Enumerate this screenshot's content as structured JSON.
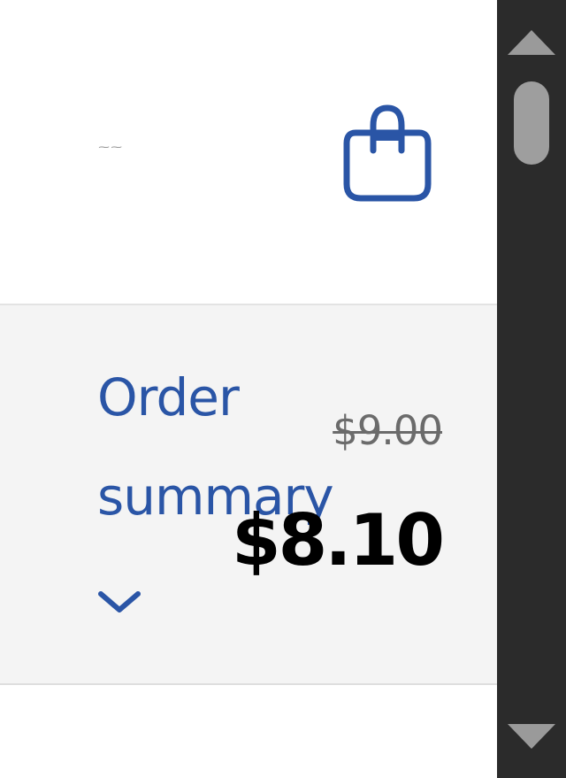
{
  "header": {
    "tiny_text": "~~",
    "cart_icon": "shopping-bag-icon"
  },
  "order_summary": {
    "label": "Order summary",
    "toggle_icon": "chevron-down-icon",
    "original_price": "$9.00",
    "current_price": "$8.10"
  },
  "scrollbar": {
    "up_icon": "arrow-up-icon",
    "down_icon": "arrow-down-icon"
  },
  "colors": {
    "accent": "#2a55a6",
    "summary_bg": "#f4f4f4",
    "scrollbar_bg": "#2b2b2b",
    "thumb": "#9e9e9e"
  }
}
